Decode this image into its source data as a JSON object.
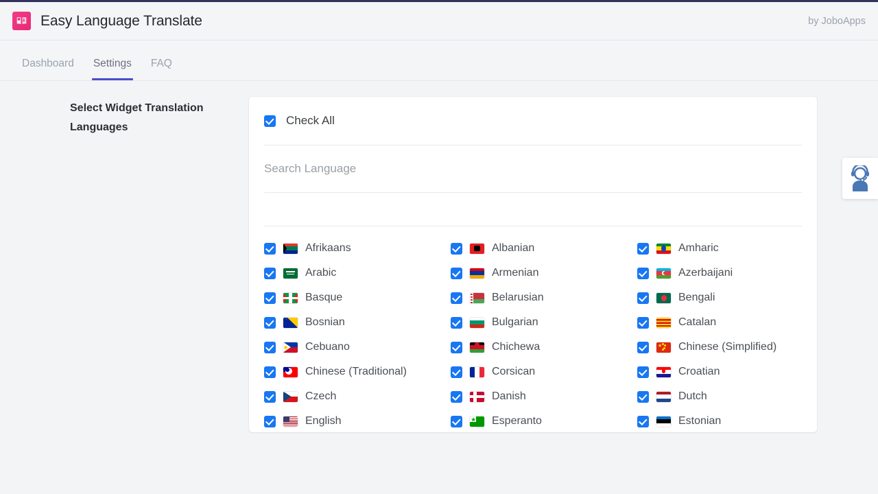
{
  "header": {
    "logo_icon": "translate-book-icon",
    "logo_color": "#ef2d7e",
    "title": "Easy Language Translate",
    "byline": "by JoboApps"
  },
  "nav": {
    "tabs": [
      {
        "label": "Dashboard",
        "active": false
      },
      {
        "label": "Settings",
        "active": true
      },
      {
        "label": "FAQ",
        "active": false
      }
    ],
    "active_indicator_color": "#4c4ccc"
  },
  "sidebar": {
    "section_title": "Select Widget Translation Languages"
  },
  "card": {
    "check_all": {
      "label": "Check All",
      "checked": true
    },
    "search": {
      "value": "",
      "placeholder": "Search Language"
    },
    "checkbox_color": "#1877f2",
    "languages": [
      {
        "name": "Afrikaans",
        "flag": "za",
        "checked": true
      },
      {
        "name": "Albanian",
        "flag": "al",
        "checked": true
      },
      {
        "name": "Amharic",
        "flag": "et",
        "checked": true
      },
      {
        "name": "Arabic",
        "flag": "sa",
        "checked": true
      },
      {
        "name": "Armenian",
        "flag": "am",
        "checked": true
      },
      {
        "name": "Azerbaijani",
        "flag": "az",
        "checked": true
      },
      {
        "name": "Basque",
        "flag": "eus",
        "checked": true
      },
      {
        "name": "Belarusian",
        "flag": "by",
        "checked": true
      },
      {
        "name": "Bengali",
        "flag": "bd",
        "checked": true
      },
      {
        "name": "Bosnian",
        "flag": "ba",
        "checked": true
      },
      {
        "name": "Bulgarian",
        "flag": "bg",
        "checked": true
      },
      {
        "name": "Catalan",
        "flag": "cat",
        "checked": true
      },
      {
        "name": "Cebuano",
        "flag": "ph",
        "checked": true
      },
      {
        "name": "Chichewa",
        "flag": "mw",
        "checked": true
      },
      {
        "name": "Chinese (Simplified)",
        "flag": "cn",
        "checked": true
      },
      {
        "name": "Chinese (Traditional)",
        "flag": "tw",
        "checked": true
      },
      {
        "name": "Corsican",
        "flag": "fr",
        "checked": true
      },
      {
        "name": "Croatian",
        "flag": "hr",
        "checked": true
      },
      {
        "name": "Czech",
        "flag": "cz",
        "checked": true
      },
      {
        "name": "Danish",
        "flag": "dk",
        "checked": true
      },
      {
        "name": "Dutch",
        "flag": "nl",
        "checked": true
      },
      {
        "name": "English",
        "flag": "us",
        "checked": true
      },
      {
        "name": "Esperanto",
        "flag": "eo",
        "checked": true
      },
      {
        "name": "Estonian",
        "flag": "ee",
        "checked": true
      }
    ]
  },
  "support_widget": {
    "icon": "headset-agent-icon",
    "color": "#4a78b5"
  }
}
